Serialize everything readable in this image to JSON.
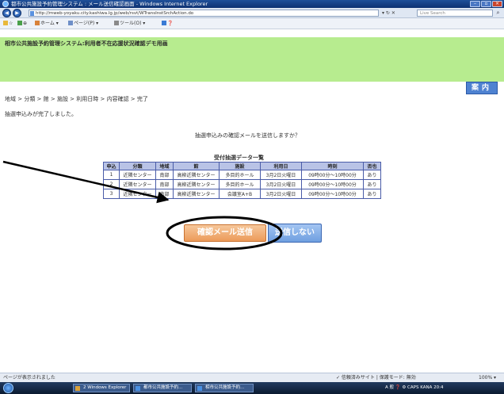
{
  "window": {
    "title": "都市公共施設予約管理システム : メール送信確認画面 - Windows Internet Explorer",
    "url": "http://mweb-yoyaku.city.kashiwa.lg.jp/web/rsvt/WTransInstSrchAction.do",
    "search_placeholder": "Live Search",
    "addr_tools": "▾ ↻ ✕"
  },
  "toolbar": {
    "items": [
      "☆",
      "⊕",
      "ホーム ▾",
      "ページ(P) ▾",
      "ツール(O) ▾",
      "❓"
    ]
  },
  "page": {
    "app_title": "相市公共施設予約管理システム:利用者不在応援状況確認デモ用画",
    "help_label": "案内",
    "breadcrumb": "地域 > 分類 > 館 > 施設 > 利用日時 > 内容確認 > 完了",
    "complete_message": "抽選申込みが完了しました。",
    "confirm_question": "抽選申込みの確認メールを送信しますか？",
    "table_title": "受付抽選データ一覧",
    "columns": [
      "申込",
      "分類",
      "地域",
      "館",
      "施設",
      "利用日",
      "時刻",
      "否也"
    ],
    "rows": [
      [
        "1",
        "近隣センター",
        "南部",
        "高柳近隣センター",
        "多目的ホール",
        "3月2日火曜日",
        "09時00分～10時00分",
        "あり"
      ],
      [
        "2",
        "近隣センター",
        "南部",
        "高柳近隣センター",
        "多目的ホール",
        "3月2日火曜日",
        "09時00分～10時00分",
        "あり"
      ],
      [
        "3",
        "近隣センター",
        "南部",
        "高柳近隣センター",
        "会議室A+B",
        "3月2日火曜日",
        "09時00分～10時00分",
        "あり"
      ]
    ],
    "send_button": "確認メール送信",
    "no_send_button": "送信しない"
  },
  "status": {
    "left": "ページが表示されました",
    "zone": "✓ 信頼済みサイト | 保護モード: 無効",
    "zoom": "100% ▾"
  },
  "taskbar": {
    "tasks": [
      "2 Windows Explorer",
      "都市公共施設予約...",
      "相市公共施設予約..."
    ],
    "tray": "A 般 ❓ ⚙ CAPS KANA 20:4"
  },
  "colors": {
    "header_band": "#b7ec8f",
    "help_button": "#4e82d1",
    "table_header": "#b9c3e6",
    "send_button": "#ec9b5a",
    "no_send_button": "#6f9fe0",
    "taskbar": "#0b1a30"
  }
}
